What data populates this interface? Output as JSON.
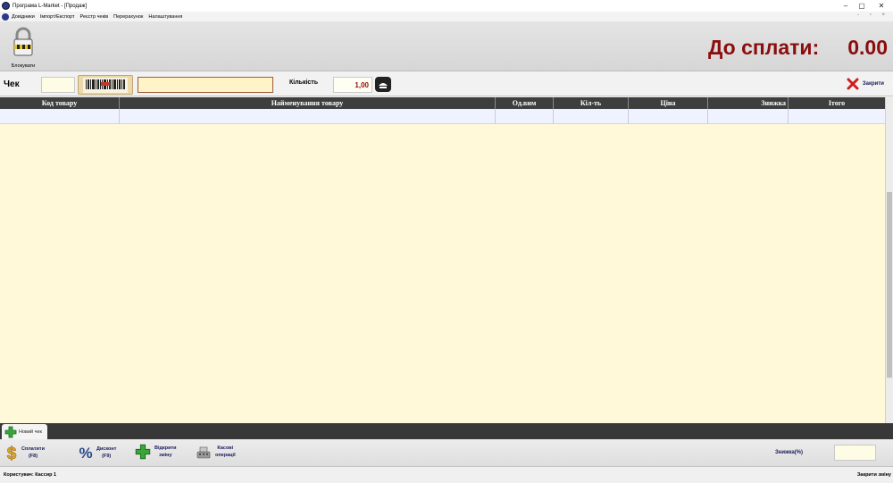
{
  "window": {
    "title": "Програма L-Market - [Продаж]",
    "min": "–",
    "max": "▢",
    "close": "✕"
  },
  "menu": {
    "items": [
      "Довідники",
      "Імпорт/Експорт",
      "Реєстр чеків",
      "Перерахунок",
      "Налаштування"
    ],
    "right_controls": "- ▫ ×"
  },
  "toolbar": {
    "lock_label": "Блокувати"
  },
  "amount_due": {
    "label": "До сплати:",
    "value": "0.00"
  },
  "receipt_bar": {
    "receipt_label": "Чек",
    "receipt_number": "",
    "scan_value": "",
    "quantity_label": "Кількість",
    "quantity_value": "1,00",
    "close_label": "Закрити"
  },
  "grid": {
    "columns": [
      "Код товару",
      "Найменування товару",
      "Од.вим",
      "Кіл-ть",
      "Ціна",
      "Знижка",
      "Ітого"
    ],
    "rows": []
  },
  "tabs": [
    {
      "label": "Новий чек"
    }
  ],
  "bottom_actions": {
    "pay_line1": "Сплатити",
    "pay_line2": "(F8)",
    "discount_line1": "Дисконт",
    "discount_line2": "(F9)",
    "open_shift_line1": "Відкрити",
    "open_shift_line2": "зміну",
    "cash_ops_line1": "Касові",
    "cash_ops_line2": "операції",
    "discount_percent_label": "Знижка(%)",
    "discount_percent_value": ""
  },
  "status": {
    "user": "Користувач: Кассир 1",
    "close_shift": "Закрити зміну"
  },
  "colors": {
    "due_red": "#8b0d0d",
    "grid_bg": "#fff9d9",
    "header_dark": "#3e3e3e",
    "button_text": "#1a1a5a"
  }
}
